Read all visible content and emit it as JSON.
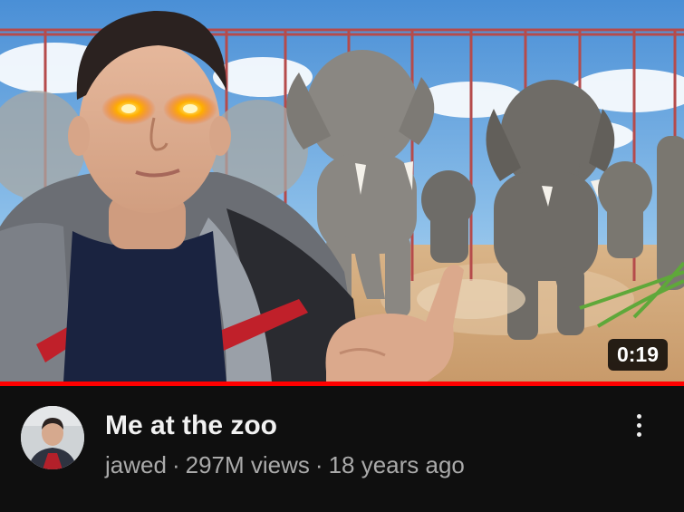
{
  "video": {
    "title": "Me at the zoo",
    "duration": "0:19",
    "watch_progress": 1.0
  },
  "channel": {
    "name": "jawed"
  },
  "stats": {
    "views": "297M views",
    "age": "18 years ago",
    "separator": "·"
  },
  "menu": {
    "icon": "more-vert-icon"
  },
  "colors": {
    "progress": "#ff0000",
    "background": "#0f0f0f",
    "title": "#f1f1f1",
    "secondary": "#aaaaaa"
  }
}
